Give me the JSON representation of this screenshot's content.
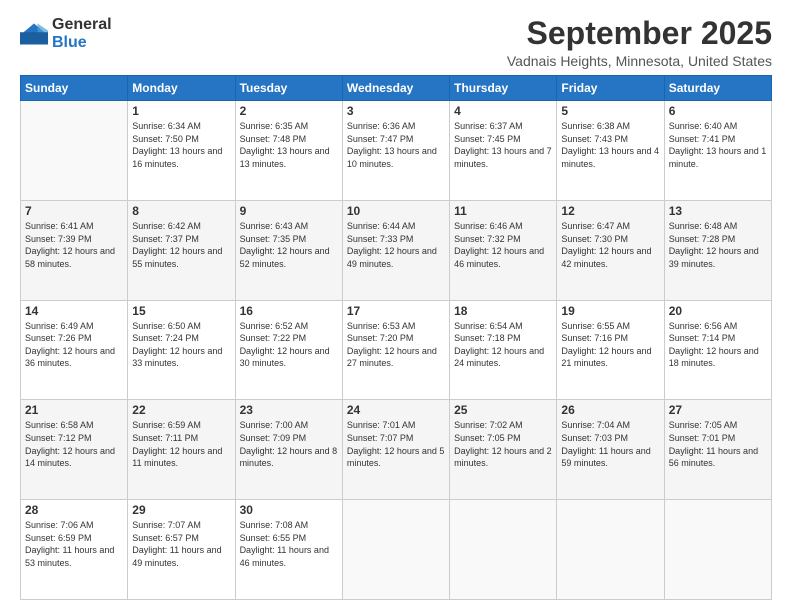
{
  "logo": {
    "text_general": "General",
    "text_blue": "Blue"
  },
  "title": {
    "main": "September 2025",
    "sub": "Vadnais Heights, Minnesota, United States"
  },
  "headers": [
    "Sunday",
    "Monday",
    "Tuesday",
    "Wednesday",
    "Thursday",
    "Friday",
    "Saturday"
  ],
  "weeks": [
    [
      {
        "day": "",
        "sunrise": "",
        "sunset": "",
        "daylight": ""
      },
      {
        "day": "1",
        "sunrise": "Sunrise: 6:34 AM",
        "sunset": "Sunset: 7:50 PM",
        "daylight": "Daylight: 13 hours and 16 minutes."
      },
      {
        "day": "2",
        "sunrise": "Sunrise: 6:35 AM",
        "sunset": "Sunset: 7:48 PM",
        "daylight": "Daylight: 13 hours and 13 minutes."
      },
      {
        "day": "3",
        "sunrise": "Sunrise: 6:36 AM",
        "sunset": "Sunset: 7:47 PM",
        "daylight": "Daylight: 13 hours and 10 minutes."
      },
      {
        "day": "4",
        "sunrise": "Sunrise: 6:37 AM",
        "sunset": "Sunset: 7:45 PM",
        "daylight": "Daylight: 13 hours and 7 minutes."
      },
      {
        "day": "5",
        "sunrise": "Sunrise: 6:38 AM",
        "sunset": "Sunset: 7:43 PM",
        "daylight": "Daylight: 13 hours and 4 minutes."
      },
      {
        "day": "6",
        "sunrise": "Sunrise: 6:40 AM",
        "sunset": "Sunset: 7:41 PM",
        "daylight": "Daylight: 13 hours and 1 minute."
      }
    ],
    [
      {
        "day": "7",
        "sunrise": "Sunrise: 6:41 AM",
        "sunset": "Sunset: 7:39 PM",
        "daylight": "Daylight: 12 hours and 58 minutes."
      },
      {
        "day": "8",
        "sunrise": "Sunrise: 6:42 AM",
        "sunset": "Sunset: 7:37 PM",
        "daylight": "Daylight: 12 hours and 55 minutes."
      },
      {
        "day": "9",
        "sunrise": "Sunrise: 6:43 AM",
        "sunset": "Sunset: 7:35 PM",
        "daylight": "Daylight: 12 hours and 52 minutes."
      },
      {
        "day": "10",
        "sunrise": "Sunrise: 6:44 AM",
        "sunset": "Sunset: 7:33 PM",
        "daylight": "Daylight: 12 hours and 49 minutes."
      },
      {
        "day": "11",
        "sunrise": "Sunrise: 6:46 AM",
        "sunset": "Sunset: 7:32 PM",
        "daylight": "Daylight: 12 hours and 46 minutes."
      },
      {
        "day": "12",
        "sunrise": "Sunrise: 6:47 AM",
        "sunset": "Sunset: 7:30 PM",
        "daylight": "Daylight: 12 hours and 42 minutes."
      },
      {
        "day": "13",
        "sunrise": "Sunrise: 6:48 AM",
        "sunset": "Sunset: 7:28 PM",
        "daylight": "Daylight: 12 hours and 39 minutes."
      }
    ],
    [
      {
        "day": "14",
        "sunrise": "Sunrise: 6:49 AM",
        "sunset": "Sunset: 7:26 PM",
        "daylight": "Daylight: 12 hours and 36 minutes."
      },
      {
        "day": "15",
        "sunrise": "Sunrise: 6:50 AM",
        "sunset": "Sunset: 7:24 PM",
        "daylight": "Daylight: 12 hours and 33 minutes."
      },
      {
        "day": "16",
        "sunrise": "Sunrise: 6:52 AM",
        "sunset": "Sunset: 7:22 PM",
        "daylight": "Daylight: 12 hours and 30 minutes."
      },
      {
        "day": "17",
        "sunrise": "Sunrise: 6:53 AM",
        "sunset": "Sunset: 7:20 PM",
        "daylight": "Daylight: 12 hours and 27 minutes."
      },
      {
        "day": "18",
        "sunrise": "Sunrise: 6:54 AM",
        "sunset": "Sunset: 7:18 PM",
        "daylight": "Daylight: 12 hours and 24 minutes."
      },
      {
        "day": "19",
        "sunrise": "Sunrise: 6:55 AM",
        "sunset": "Sunset: 7:16 PM",
        "daylight": "Daylight: 12 hours and 21 minutes."
      },
      {
        "day": "20",
        "sunrise": "Sunrise: 6:56 AM",
        "sunset": "Sunset: 7:14 PM",
        "daylight": "Daylight: 12 hours and 18 minutes."
      }
    ],
    [
      {
        "day": "21",
        "sunrise": "Sunrise: 6:58 AM",
        "sunset": "Sunset: 7:12 PM",
        "daylight": "Daylight: 12 hours and 14 minutes."
      },
      {
        "day": "22",
        "sunrise": "Sunrise: 6:59 AM",
        "sunset": "Sunset: 7:11 PM",
        "daylight": "Daylight: 12 hours and 11 minutes."
      },
      {
        "day": "23",
        "sunrise": "Sunrise: 7:00 AM",
        "sunset": "Sunset: 7:09 PM",
        "daylight": "Daylight: 12 hours and 8 minutes."
      },
      {
        "day": "24",
        "sunrise": "Sunrise: 7:01 AM",
        "sunset": "Sunset: 7:07 PM",
        "daylight": "Daylight: 12 hours and 5 minutes."
      },
      {
        "day": "25",
        "sunrise": "Sunrise: 7:02 AM",
        "sunset": "Sunset: 7:05 PM",
        "daylight": "Daylight: 12 hours and 2 minutes."
      },
      {
        "day": "26",
        "sunrise": "Sunrise: 7:04 AM",
        "sunset": "Sunset: 7:03 PM",
        "daylight": "Daylight: 11 hours and 59 minutes."
      },
      {
        "day": "27",
        "sunrise": "Sunrise: 7:05 AM",
        "sunset": "Sunset: 7:01 PM",
        "daylight": "Daylight: 11 hours and 56 minutes."
      }
    ],
    [
      {
        "day": "28",
        "sunrise": "Sunrise: 7:06 AM",
        "sunset": "Sunset: 6:59 PM",
        "daylight": "Daylight: 11 hours and 53 minutes."
      },
      {
        "day": "29",
        "sunrise": "Sunrise: 7:07 AM",
        "sunset": "Sunset: 6:57 PM",
        "daylight": "Daylight: 11 hours and 49 minutes."
      },
      {
        "day": "30",
        "sunrise": "Sunrise: 7:08 AM",
        "sunset": "Sunset: 6:55 PM",
        "daylight": "Daylight: 11 hours and 46 minutes."
      },
      {
        "day": "",
        "sunrise": "",
        "sunset": "",
        "daylight": ""
      },
      {
        "day": "",
        "sunrise": "",
        "sunset": "",
        "daylight": ""
      },
      {
        "day": "",
        "sunrise": "",
        "sunset": "",
        "daylight": ""
      },
      {
        "day": "",
        "sunrise": "",
        "sunset": "",
        "daylight": ""
      }
    ]
  ]
}
